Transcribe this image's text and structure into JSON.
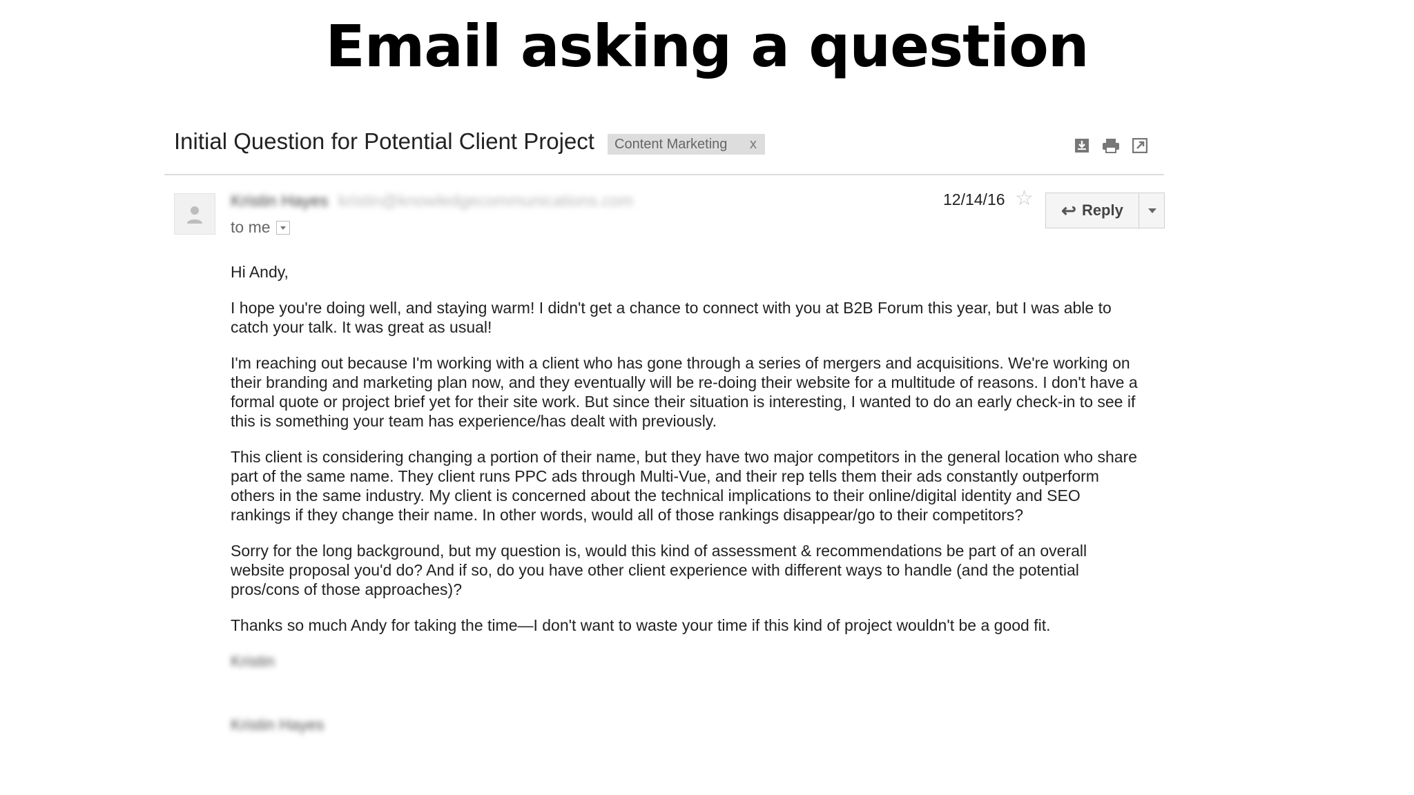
{
  "slide": {
    "title": "Email asking a question"
  },
  "email": {
    "subject": "Initial Question for Potential Client Project",
    "label": "Content Marketing",
    "label_remove": "x",
    "sender_name": "Kristin Hayes",
    "sender_email": "kristin@knowledgecommunications.com",
    "recipient": "to me",
    "date": "12/14/16",
    "reply_label": "Reply",
    "greeting": "Hi Andy,",
    "paragraphs": [
      "I hope you're doing well, and staying warm! I didn't get a chance to connect with you at B2B Forum this year, but I was able to catch your talk. It was great as usual!",
      "I'm reaching out because I'm working with a client who has gone through a series of mergers and acquisitions. We're working on their branding and marketing plan now, and they eventually will be re-doing their website for a multitude of reasons. I don't have a formal quote or project brief yet for their site work. But since their situation is interesting, I wanted to do an early check-in to see if this is something your team has experience/has dealt with previously.",
      "This client is considering changing a portion of their name, but they have two major competitors in the general location who share part of the same name. They client runs PPC ads through Multi-Vue, and their rep tells them their ads constantly outperform others in the same industry. My client is concerned about the technical implications to their online/digital identity and SEO rankings if they change their name. In other words, would all of those rankings disappear/go to their competitors?",
      "Sorry for the long background, but my question is, would this kind of assessment & recommendations be part of an overall website proposal you'd do? And if so, do you have other client experience with different ways to handle (and the potential pros/cons of those approaches)?",
      "Thanks so much Andy for taking the time—I don't want to waste your time if this kind of project wouldn't be a good fit."
    ],
    "signoff_short": "Kristin",
    "signoff_full": "Kristin Hayes"
  },
  "icons": [
    "download-icon",
    "print-icon",
    "new-window-icon",
    "avatar-icon",
    "star-icon",
    "reply-arrow-icon",
    "chevron-down-icon"
  ]
}
